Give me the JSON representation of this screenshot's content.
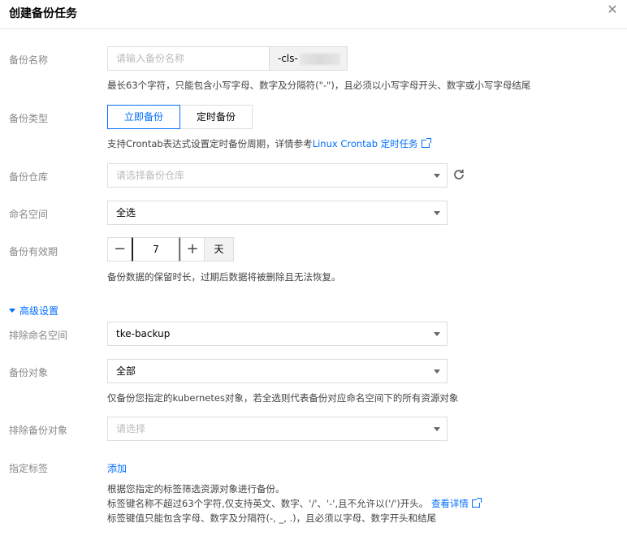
{
  "dialog": {
    "title": "创建备份任务",
    "close_icon": "close-icon"
  },
  "backup_name": {
    "label": "备份名称",
    "placeholder": "请输入备份名称",
    "suffix": "-cls-",
    "hint": "最长63个字符，只能包含小写字母、数字及分隔符(\"-\")，且必须以小写字母开头、数字或小写字母结尾"
  },
  "backup_type": {
    "label": "备份类型",
    "options": [
      "立即备份",
      "定时备份"
    ],
    "selected": "立即备份",
    "hint_prefix": "支持Crontab表达式设置定时备份周期，详情参考",
    "hint_link": "Linux Crontab 定时任务"
  },
  "backup_repo": {
    "label": "备份仓库",
    "placeholder": "请选择备份仓库",
    "refresh_icon": "refresh-icon"
  },
  "namespace": {
    "label": "命名空间",
    "value": "全选"
  },
  "retention": {
    "label": "备份有效期",
    "minus": "−",
    "value": "7",
    "plus": "+",
    "unit": "天",
    "hint": "备份数据的保留时长，过期后数据将被删除且无法恢复。"
  },
  "advanced": {
    "toggle_label": "高级设置",
    "expanded": true,
    "exclude_namespace": {
      "label": "排除命名空间",
      "value": "tke-backup"
    },
    "backup_objects": {
      "label": "备份对象",
      "value": "全部",
      "hint": "仅备份您指定的kubernetes对象，若全选则代表备份对应命名空间下的所有资源对象"
    },
    "exclude_objects": {
      "label": "排除备份对象",
      "placeholder": "请选择"
    },
    "labels": {
      "label": "指定标签",
      "add_link": "添加",
      "hint1": "根据您指定的标签筛选资源对象进行备份。",
      "hint2": "标签键名称不超过63个字符,仅支持英文、数字、'/'、'-',且不允许以('/')开头。",
      "hint2_link": "查看详情",
      "hint3": "标签键值只能包含字母、数字及分隔符(-, _, .)，且必须以字母、数字开头和结尾"
    }
  },
  "colors": {
    "accent": "#006eff",
    "label": "#888888",
    "border": "#dddddd",
    "addon_bg": "#f2f2f2"
  }
}
